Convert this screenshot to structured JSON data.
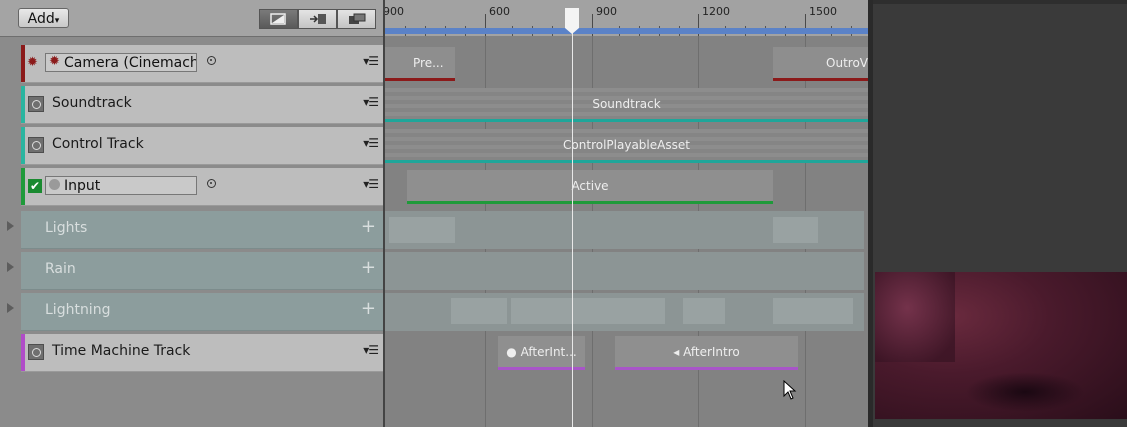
{
  "toolbar": {
    "add_label": "Add",
    "add_arrow": "▾",
    "modes": [
      "preview-mode-icon",
      "record-mode-icon",
      "edit-mode-icon"
    ]
  },
  "ruler": {
    "labels": [
      "900",
      "600",
      "900",
      "1200",
      "1500"
    ]
  },
  "tracks": [
    {
      "name": "Camera (Cinemach",
      "type": "cinemachine",
      "color": "#8b1a1a"
    },
    {
      "name": "Soundtrack",
      "type": "audio",
      "color": "#2ab5a0"
    },
    {
      "name": "Control Track",
      "type": "control",
      "color": "#2ab5a0"
    },
    {
      "name": "Input",
      "type": "activation",
      "color": "#1f9a3a",
      "checked": true
    },
    {
      "name": "Lights",
      "type": "group"
    },
    {
      "name": "Rain",
      "type": "group"
    },
    {
      "name": "Lightning",
      "type": "group"
    },
    {
      "name": "Time Machine Track",
      "type": "custom",
      "color": "#b04cc8"
    }
  ],
  "clips": {
    "camera_a": "Pre...",
    "camera_b": "OutroV",
    "soundtrack": "Soundtrack",
    "control": "ControlPlayableAsset",
    "active": "Active",
    "tm_a": "● AfterInt...",
    "tm_b": "◂  AfterIntro"
  },
  "colors": {
    "audio": "#1fa69a",
    "activation": "#1f9a3a",
    "cinemachine": "#8b1a1a",
    "timemachine": "#a855c8",
    "range": "#5b82c7"
  }
}
